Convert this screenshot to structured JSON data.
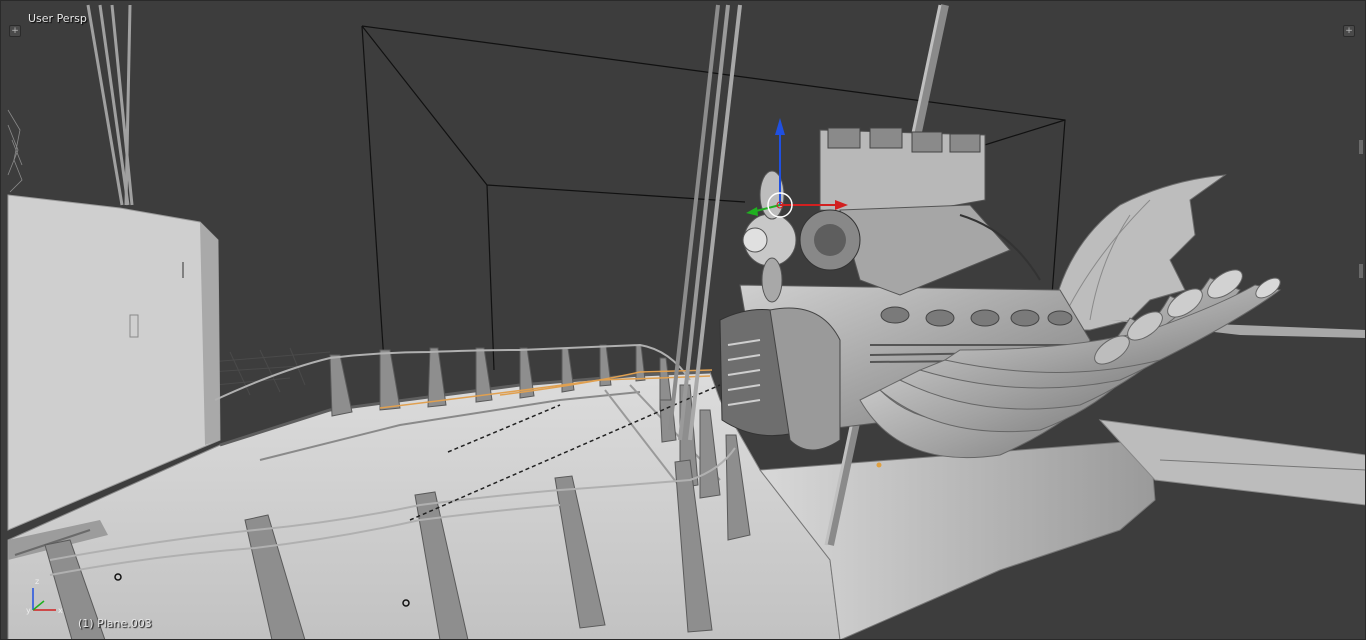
{
  "viewport": {
    "view_label": "User Persp",
    "object_label": "(1) Plane.003",
    "left_toggle_glyph": "+",
    "right_toggle_glyph": "+"
  },
  "gizmo": {
    "axis_x_color": "#d22020",
    "axis_y_color": "#20b020",
    "axis_z_color": "#2050e0"
  },
  "mini_axes": {
    "x_label": "x",
    "y_label": "y",
    "z_label": "z"
  },
  "colors": {
    "background": "#3d3d3d",
    "model_light": "#d4d4d4",
    "model_mid": "#a8a8a8",
    "model_dark": "#6e6e6e",
    "wire": "#101010",
    "selected": "#e8a040"
  }
}
